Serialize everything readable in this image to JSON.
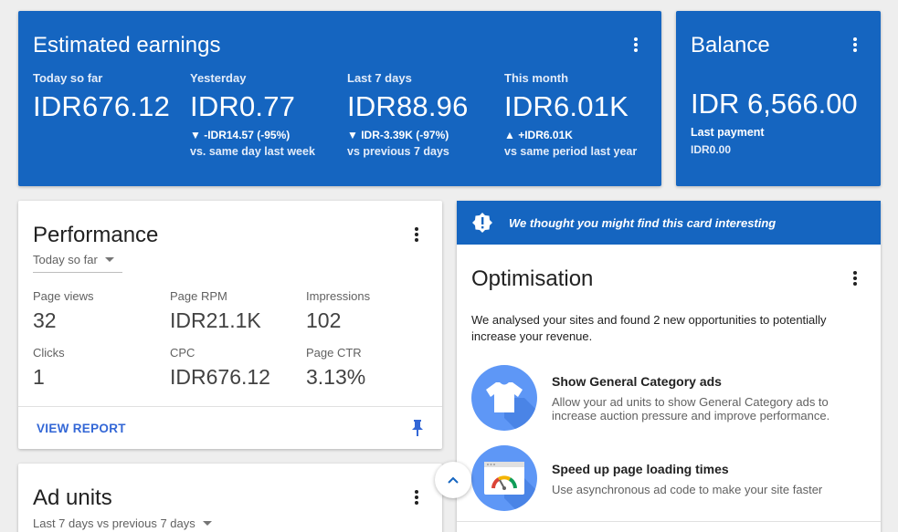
{
  "earnings": {
    "title": "Estimated earnings",
    "metrics": [
      {
        "label": "Today so far",
        "value": "IDR676.12",
        "change": "",
        "comparison": ""
      },
      {
        "label": "Yesterday",
        "value": "IDR0.77",
        "change": "▼ -IDR14.57 (-95%)",
        "comparison": "vs. same day last week"
      },
      {
        "label": "Last 7 days",
        "value": "IDR88.96",
        "change": "▼ IDR-3.39K (-97%)",
        "comparison": "vs previous 7 days"
      },
      {
        "label": "This month",
        "value": "IDR6.01K",
        "change": "▲ +IDR6.01K",
        "comparison": "vs same period last year"
      }
    ]
  },
  "balance": {
    "title": "Balance",
    "amount": "IDR 6,566.00",
    "last_payment_label": "Last payment",
    "last_payment_value": "IDR0.00"
  },
  "performance": {
    "title": "Performance",
    "range": "Today so far",
    "stats": [
      {
        "label": "Page views",
        "value": "32"
      },
      {
        "label": "Page RPM",
        "value": "IDR21.1K"
      },
      {
        "label": "Impressions",
        "value": "102"
      },
      {
        "label": "Clicks",
        "value": "1"
      },
      {
        "label": "CPC",
        "value": "IDR676.12"
      },
      {
        "label": "Page CTR",
        "value": "3.13%"
      }
    ],
    "view_report": "VIEW REPORT"
  },
  "ad_units": {
    "title": "Ad units",
    "range": "Last 7 days vs previous 7 days"
  },
  "optimisation": {
    "banner": "We thought you might find this card interesting",
    "title": "Optimisation",
    "description": "We analysed your sites and found 2 new opportunities to potentially increase your revenue.",
    "opportunities": [
      {
        "title": "Show General Category ads",
        "description": "Allow your ad units to show General Category ads to increase auction pressure and improve performance.",
        "icon": "tshirt-icon"
      },
      {
        "title": "Speed up page loading times",
        "description": "Use asynchronous ad code to make your site faster",
        "icon": "speedometer-icon"
      }
    ]
  },
  "colors": {
    "primary_blue": "#1565c0",
    "link_blue": "#3367d6",
    "icon_circle": "#5e97f6"
  }
}
